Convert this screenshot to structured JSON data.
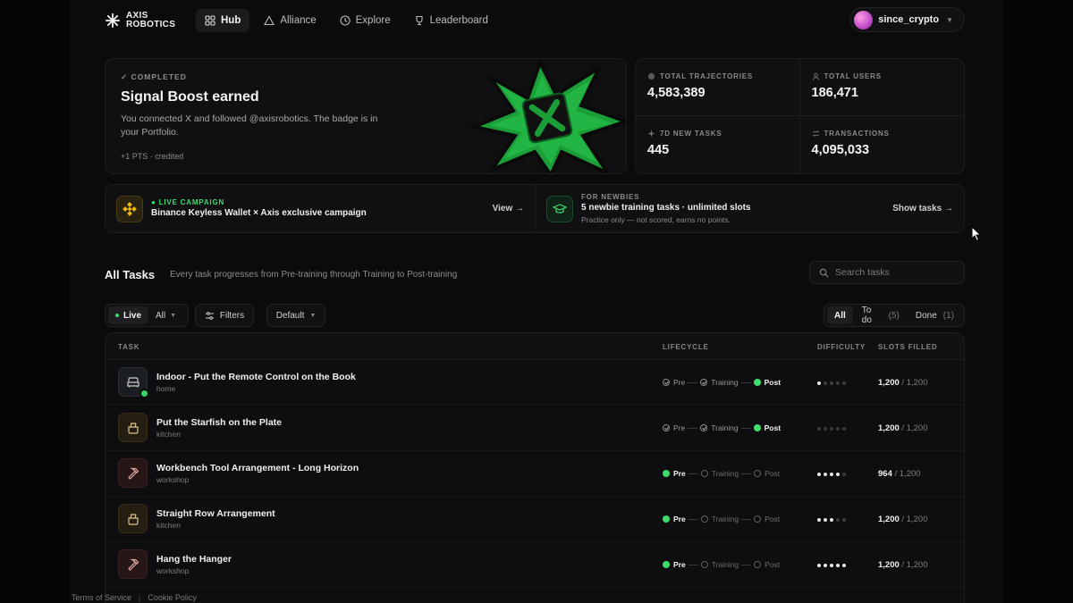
{
  "nav": {
    "brand_line1": "AXIS",
    "brand_line2": "ROBOTICS",
    "items": [
      {
        "label": "Hub",
        "icon": "grid-icon",
        "active": true
      },
      {
        "label": "Alliance",
        "icon": "triangle-icon",
        "active": false
      },
      {
        "label": "Explore",
        "icon": "compass-icon",
        "active": false
      },
      {
        "label": "Leaderboard",
        "icon": "trophy-icon",
        "active": false
      }
    ],
    "user": "since_crypto"
  },
  "hero": {
    "status": "COMPLETED",
    "title": "Signal Boost earned",
    "body": "You connected X and followed @axisrobotics. The badge is in your Portfolio.",
    "points": "+1 PTS · credited"
  },
  "stats": [
    {
      "label": "TOTAL TRAJECTORIES",
      "value": "4,583,389"
    },
    {
      "label": "TOTAL USERS",
      "value": "186,471"
    },
    {
      "label": "7D NEW TASKS",
      "value": "445"
    },
    {
      "label": "TRANSACTIONS",
      "value": "4,095,033"
    }
  ],
  "campaigns": [
    {
      "tag": "LIVE CAMPAIGN",
      "title": "Binance Keyless Wallet × Axis exclusive campaign",
      "sub": "",
      "link": "View →"
    },
    {
      "tag": "FOR NEWBIES",
      "title": "5 newbie training tasks · unlimited slots",
      "sub": "Practice only — not scored, earns no points.",
      "link": "Show tasks →"
    }
  ],
  "tasks_section": {
    "title": "All Tasks",
    "desc": "Every task progresses from Pre-training through Training to Post-training",
    "search_placeholder": "Search tasks"
  },
  "filters": {
    "live": "Live",
    "all_dropdown": "All",
    "filters": "Filters",
    "sort": "Default",
    "tabs": [
      {
        "label": "All",
        "count": ""
      },
      {
        "label": "To do",
        "count": "(5)"
      },
      {
        "label": "Done",
        "count": "(1)"
      }
    ]
  },
  "table": {
    "headers": {
      "task": "TASK",
      "lifecycle": "LIFECYCLE",
      "difficulty": "DIFFICULTY",
      "slots": "SLOTS FILLED"
    },
    "stage_labels": [
      "Pre",
      "Training",
      "Post"
    ],
    "rows": [
      {
        "name": "Indoor - Put the Remote Control on the Book",
        "category": "home",
        "icon": "sofa-icon",
        "stage": 2,
        "difficulty": 1,
        "filled": "1,200",
        "total": "/ 1,200",
        "completed": true
      },
      {
        "name": "Put the Starfish on the Plate",
        "category": "kitchen",
        "icon": "pot-icon",
        "stage": 2,
        "difficulty": 0,
        "filled": "1,200",
        "total": "/ 1,200",
        "completed": false
      },
      {
        "name": "Workbench Tool Arrangement - Long Horizon",
        "category": "workshop",
        "icon": "hammer-icon",
        "stage": 0,
        "difficulty": 4,
        "filled": "964",
        "total": "/ 1,200",
        "completed": false
      },
      {
        "name": "Straight Row Arrangement",
        "category": "kitchen",
        "icon": "pot-icon",
        "stage": 0,
        "difficulty": 3,
        "filled": "1,200",
        "total": "/ 1,200",
        "completed": false
      },
      {
        "name": "Hang the Hanger",
        "category": "workshop",
        "icon": "hammer-icon",
        "stage": 0,
        "difficulty": 5,
        "filled": "1,200",
        "total": "/ 1,200",
        "completed": false
      }
    ]
  },
  "footer": {
    "terms": "Terms of Service",
    "cookie": "Cookie Policy"
  },
  "colors": {
    "accent_green": "#3ddc6c",
    "binance_yellow": "#f0b90b"
  }
}
